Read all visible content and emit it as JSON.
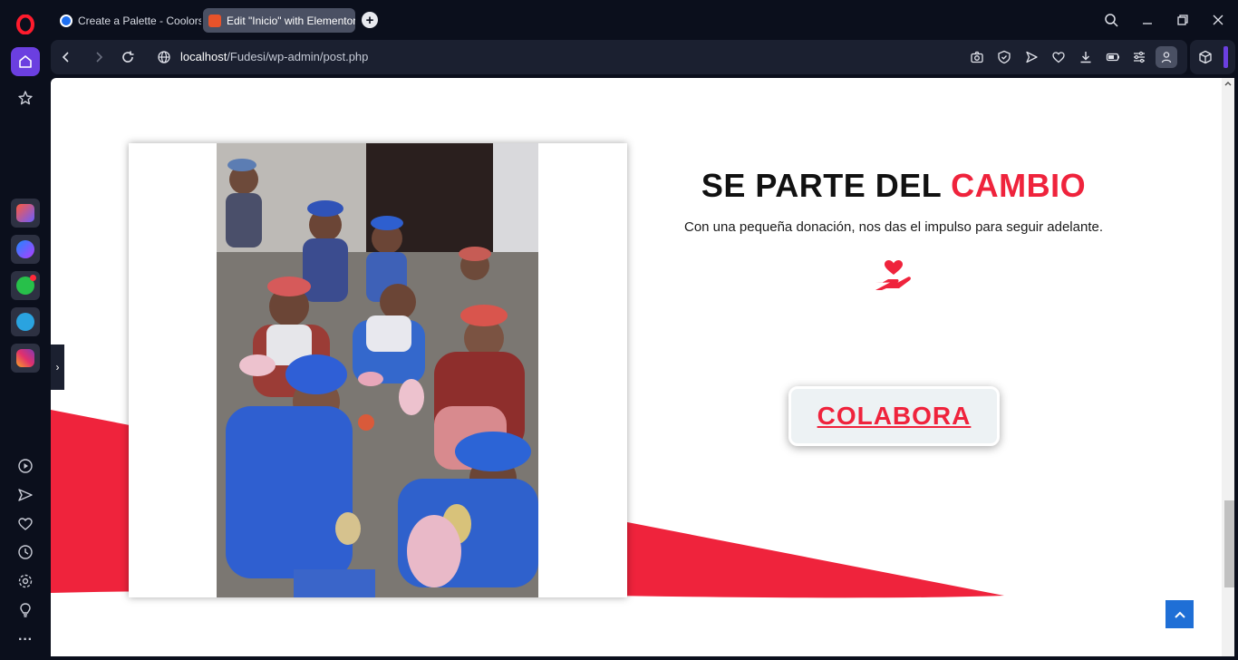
{
  "browser": {
    "tabs": [
      {
        "title": "Create a Palette - Coolors",
        "active": false
      },
      {
        "title": "Edit \"Inicio\" with Elementor",
        "active": true
      }
    ],
    "url_host": "localhost",
    "url_path": "/Fudesi/wp-admin/post.php"
  },
  "sidebar": {
    "apps": [
      "aria-icon",
      "messenger-icon",
      "whatsapp-icon",
      "telegram-icon",
      "instagram-icon"
    ],
    "bottom_icons": [
      "player-icon",
      "send-icon",
      "heart-icon",
      "history-icon",
      "settings-icon",
      "lightbulb-icon",
      "more-icon"
    ]
  },
  "toolbar_icons": [
    "camera-icon",
    "shield-icon",
    "play-icon",
    "heart-icon",
    "download-icon",
    "battery-icon",
    "easy-setup-icon",
    "profile-icon"
  ],
  "page": {
    "heading_main": "SE PARTE DEL ",
    "heading_accent": "CAMBIO",
    "subtext": "Con una pequeña donación, nos das el impulso para seguir adelante.",
    "button_label": "COLABORA",
    "accent_color": "#ef233c",
    "button_bg": "#edf2f4"
  },
  "side_toggle": "›"
}
